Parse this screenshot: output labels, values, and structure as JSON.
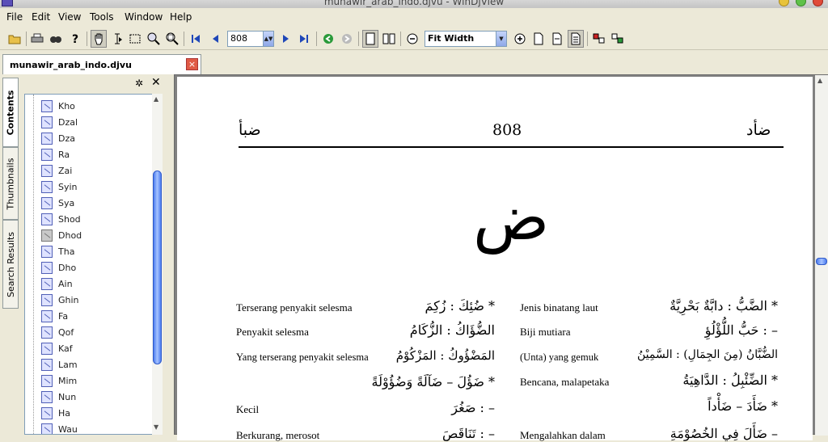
{
  "window": {
    "title": "munawir_arab_indo.djvu - WinDjView"
  },
  "menu": [
    "File",
    "Edit",
    "View",
    "Tools",
    "Window",
    "Help"
  ],
  "toolbar": {
    "page_number": "808",
    "zoom": "Fit Width",
    "icons": [
      "open-folder-icon",
      "print-icon",
      "find-icon",
      "help-icon",
      "hand-icon",
      "text-select-icon",
      "rect-select-icon",
      "zoom-icon",
      "zoom-rect-icon",
      "first-page-icon",
      "prev-page-icon",
      "next-page-icon",
      "last-page-icon",
      "back-icon",
      "forward-icon",
      "single-page-icon",
      "two-page-icon",
      "zoom-out-icon",
      "zoom-in-icon",
      "page-icon",
      "page-width-icon",
      "page-fit-icon",
      "display-mode-icon",
      "layer-icon"
    ]
  },
  "tab": {
    "label": "munawir_arab_indo.djvu"
  },
  "side_tabs": [
    "Contents",
    "Thumbnails",
    "Search Results"
  ],
  "contents": {
    "items": [
      "Kho",
      "Dzal",
      "Dza",
      "Ra",
      "Zai",
      "Syin",
      "Sya",
      "Shod",
      "Dhod",
      "Tha",
      "Dho",
      "Ain",
      "Ghin",
      "Fa",
      "Qof",
      "Kaf",
      "Lam",
      "Mim",
      "Nun",
      "Ha",
      "Wau"
    ],
    "selected": "Dhod"
  },
  "page": {
    "header_left": "ضبأ",
    "header_number": "808",
    "header_right": "ضأد",
    "big_letter": "ض",
    "right_col": [
      {
        "arabic": "* الضَّبُّ : دابَّةٌ بَحْرِيَّةٌ",
        "meaning": "Jenis binatang laut"
      },
      {
        "arabic": "– : حَبُّ اللُّؤْلُؤِ",
        "meaning": "Biji mutiara"
      },
      {
        "arabic": "الضُّبَّانُ (مِنَ الجِمَالِ) : السَّمِيْنُ",
        "meaning": "(Unta) yang gemuk"
      },
      {
        "arabic": "* الضِّئْبِلُ : الدَّاهِيَةُ",
        "meaning": "Bencana, malapetaka"
      },
      {
        "arabic": "* ضَأَدَ – ضَأْداً",
        "meaning": ""
      },
      {
        "arabic": "– ضَأَلَ فِي الخُصُوْمَةِ",
        "meaning": "Mengalahkan dalam"
      }
    ],
    "left_col": [
      {
        "arabic": "* ضُئِكَ : زُكِمَ",
        "meaning": "Terserang penyakit selesma"
      },
      {
        "arabic": "الضُّؤَاكُ : الزُّكَامُ",
        "meaning": "Penyakit selesma"
      },
      {
        "arabic": "المَضْؤُوكُ : المَزْكُوْمُ",
        "meaning": "Yang terserang penyakit selesma"
      },
      {
        "arabic": "* ضَؤُلَ – ضَآلَةً وَضُؤُوْلَةً",
        "meaning": ""
      },
      {
        "arabic": "– : صَغُرَ",
        "meaning": "Kecil"
      },
      {
        "arabic": "– : تَنَاقَصَ",
        "meaning": "Berkurang, merosot"
      }
    ]
  },
  "colors": {
    "accent": "#316ac5",
    "page": "#ffffff",
    "viewer_bg": "#808080"
  }
}
